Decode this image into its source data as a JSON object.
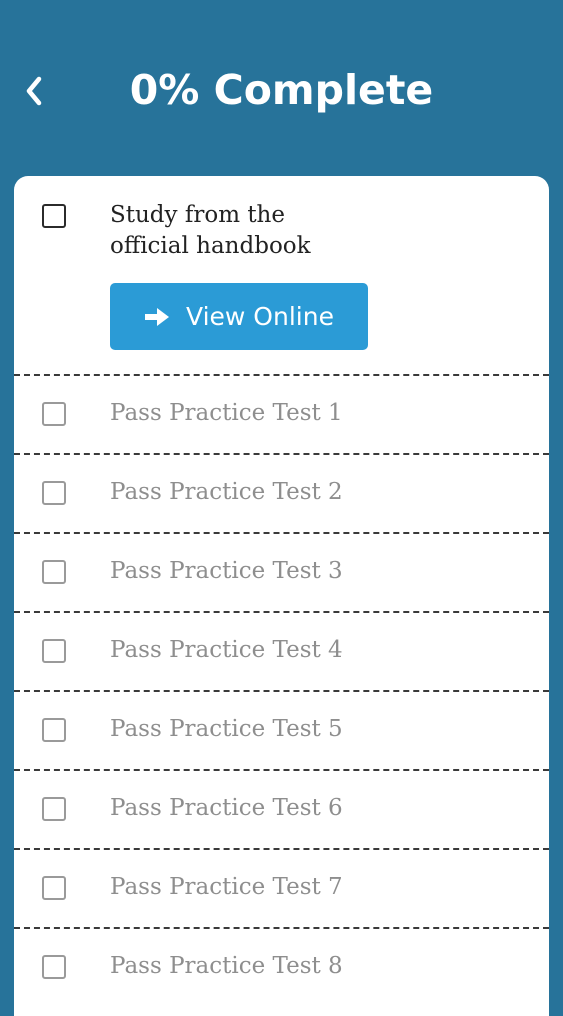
{
  "header": {
    "back_icon": "chevron-left-icon",
    "title": "0% Complete"
  },
  "tasks": [
    {
      "label": "Study from the official handbook",
      "checked": false,
      "button": {
        "icon": "arrow-right-icon",
        "label": "View Online"
      }
    },
    {
      "label": "Pass Practice Test 1",
      "checked": false
    },
    {
      "label": "Pass Practice Test 2",
      "checked": false
    },
    {
      "label": "Pass Practice Test 3",
      "checked": false
    },
    {
      "label": "Pass Practice Test 4",
      "checked": false
    },
    {
      "label": "Pass Practice Test 5",
      "checked": false
    },
    {
      "label": "Pass Practice Test 6",
      "checked": false
    },
    {
      "label": "Pass Practice Test 7",
      "checked": false
    },
    {
      "label": "Pass Practice Test 8",
      "checked": false
    }
  ],
  "colors": {
    "background": "#27739a",
    "card": "#ffffff",
    "button": "#2b9bd6",
    "text_primary": "#222222",
    "text_muted": "#8e8e8e"
  }
}
